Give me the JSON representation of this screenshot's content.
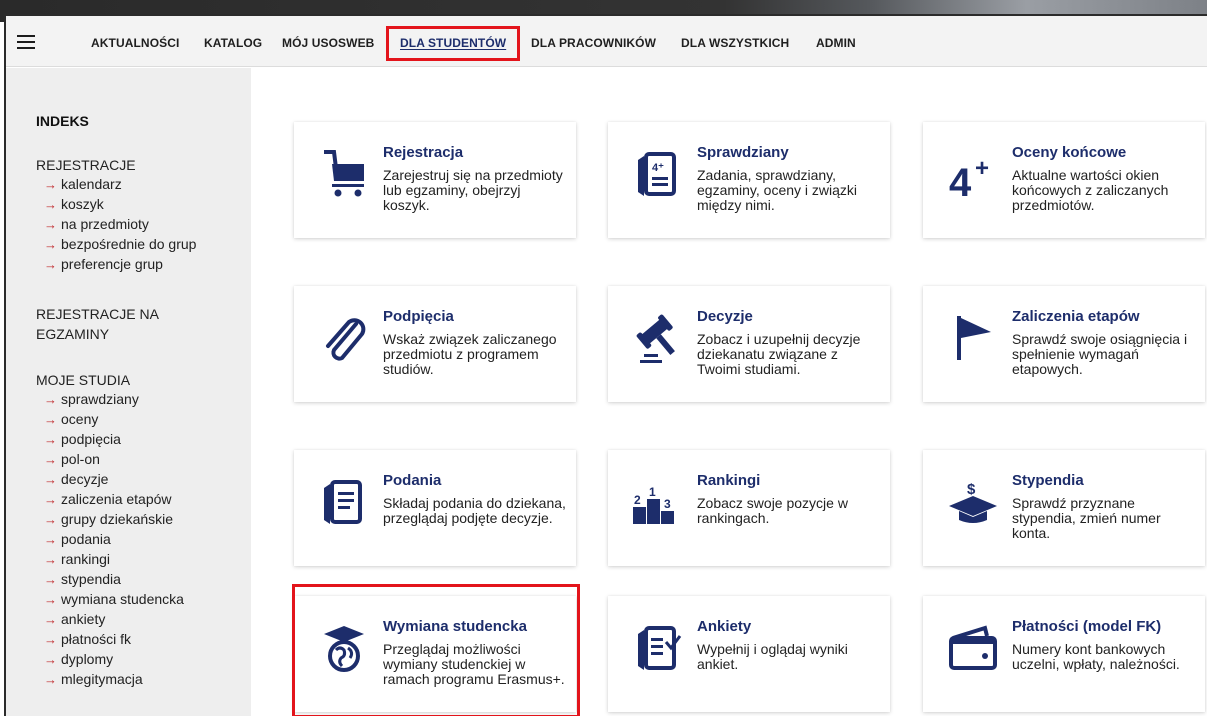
{
  "nav": {
    "items": [
      {
        "label": "AKTUALNOŚCI"
      },
      {
        "label": "KATALOG"
      },
      {
        "label": "MÓJ USOSWEB"
      },
      {
        "label": "DLA STUDENTÓW"
      },
      {
        "label": "DLA PRACOWNIKÓW"
      },
      {
        "label": "DLA WSZYSTKICH"
      },
      {
        "label": "ADMIN"
      }
    ],
    "active": "DLA STUDENTÓW"
  },
  "sidebar": {
    "heading": "INDEKS",
    "sections": [
      {
        "title": "REJESTRACJE",
        "links": [
          "kalendarz",
          "koszyk",
          "na przedmioty",
          "bezpośrednie do grup",
          "preferencje grup"
        ]
      },
      {
        "title": "REJESTRACJE NA EGZAMINY",
        "links": []
      },
      {
        "title": "MOJE STUDIA",
        "links": [
          "sprawdziany",
          "oceny",
          "podpięcia",
          "pol-on",
          "decyzje",
          "zaliczenia etapów",
          "grupy dziekańskie",
          "podania",
          "rankingi",
          "stypendia",
          "wymiana studencka",
          "ankiety",
          "płatności fk",
          "dyplomy",
          "mlegitymacja"
        ]
      }
    ]
  },
  "cards": [
    {
      "title": "Rejestracja",
      "desc": "Zarejestruj się na przedmioty lub egzaminy, obejrzyj koszyk.",
      "icon": "cart-icon"
    },
    {
      "title": "Sprawdziany",
      "desc": "Zadania, sprawdziany, egzaminy, oceny i związki między nimi.",
      "icon": "test-sheet-icon"
    },
    {
      "title": "Oceny końcowe",
      "desc": "Aktualne wartości okien końcowych z zaliczanych przedmiotów.",
      "icon": "grade-4plus-icon"
    },
    {
      "title": "Podpięcia",
      "desc": "Wskaż związek zaliczanego przedmiotu z programem studiów.",
      "icon": "paperclip-icon"
    },
    {
      "title": "Decyzje",
      "desc": "Zobacz i uzupełnij decyzje dziekanatu związane z Twoimi studiami.",
      "icon": "gavel-icon"
    },
    {
      "title": "Zaliczenia etapów",
      "desc": "Sprawdź swoje osiągnięcia i spełnienie wymagań etapowych.",
      "icon": "flag-icon"
    },
    {
      "title": "Podania",
      "desc": "Składaj podania do dziekana, przeglądaj podjęte decyzje.",
      "icon": "document-icon"
    },
    {
      "title": "Rankingi",
      "desc": "Zobacz swoje pozycje w rankingach.",
      "icon": "podium-icon"
    },
    {
      "title": "Stypendia",
      "desc": "Sprawdź przyznane stypendia, zmień numer konta.",
      "icon": "scholarship-cap-icon"
    },
    {
      "title": "Wymiana studencka",
      "desc": "Przeglądaj możliwości wymiany studenckiej w ramach programu Erasmus+.",
      "icon": "globe-cap-icon"
    },
    {
      "title": "Ankiety",
      "desc": "Wypełnij i oglądaj wyniki ankiet.",
      "icon": "survey-icon"
    },
    {
      "title": "Płatności (model FK)",
      "desc": "Numery kont bankowych uczelni, wpłaty, należności.",
      "icon": "wallet-icon"
    }
  ],
  "colors": {
    "brand": "#1d2d6b",
    "highlight": "#e3141b",
    "arrow": "#c0282b",
    "sidebar_bg": "#eeeeee"
  }
}
